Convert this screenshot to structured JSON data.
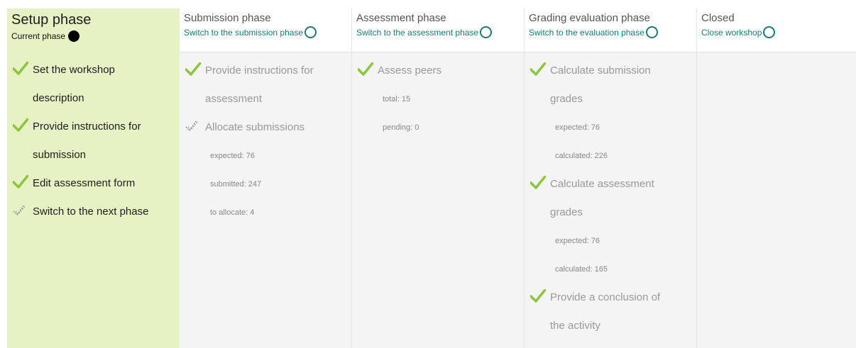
{
  "phases": [
    {
      "title": "Setup phase",
      "current_label": "Current phase",
      "tasks": [
        {
          "label": "Set the workshop description",
          "status": "done"
        },
        {
          "label": "Provide instructions for submission",
          "status": "done"
        },
        {
          "label": "Edit assessment form",
          "status": "done"
        },
        {
          "label": "Switch to the next phase",
          "status": "todo"
        }
      ]
    },
    {
      "title": "Submission phase",
      "action_label": "Switch to the submission phase",
      "tasks": [
        {
          "label": "Provide instructions for assessment",
          "status": "done"
        },
        {
          "label": "Allocate submissions",
          "status": "todo",
          "info": [
            "expected: 76",
            "submitted: 247",
            "to allocate: 4"
          ]
        }
      ]
    },
    {
      "title": "Assessment phase",
      "action_label": "Switch to the assessment phase",
      "tasks": [
        {
          "label": "Assess peers",
          "status": "done",
          "info": [
            "total: 15",
            "pending: 0"
          ]
        }
      ]
    },
    {
      "title": "Grading evaluation phase",
      "action_label": "Switch to the evaluation phase",
      "tasks": [
        {
          "label": "Calculate submission grades",
          "status": "done",
          "info": [
            "expected: 76",
            "calculated: 226"
          ]
        },
        {
          "label": "Calculate assessment grades",
          "status": "done",
          "info": [
            "expected: 76",
            "calculated: 165"
          ]
        },
        {
          "label": "Provide a conclusion of the activity",
          "status": "done"
        }
      ]
    },
    {
      "title": "Closed",
      "action_label": "Close workshop",
      "tasks": []
    }
  ],
  "colors": {
    "active_bg": "#e6f2c4",
    "inactive_bg": "#f4f4f4",
    "check_done": "#8cc63e",
    "check_todo": "#9a9a9a",
    "link": "#1a7a78"
  }
}
